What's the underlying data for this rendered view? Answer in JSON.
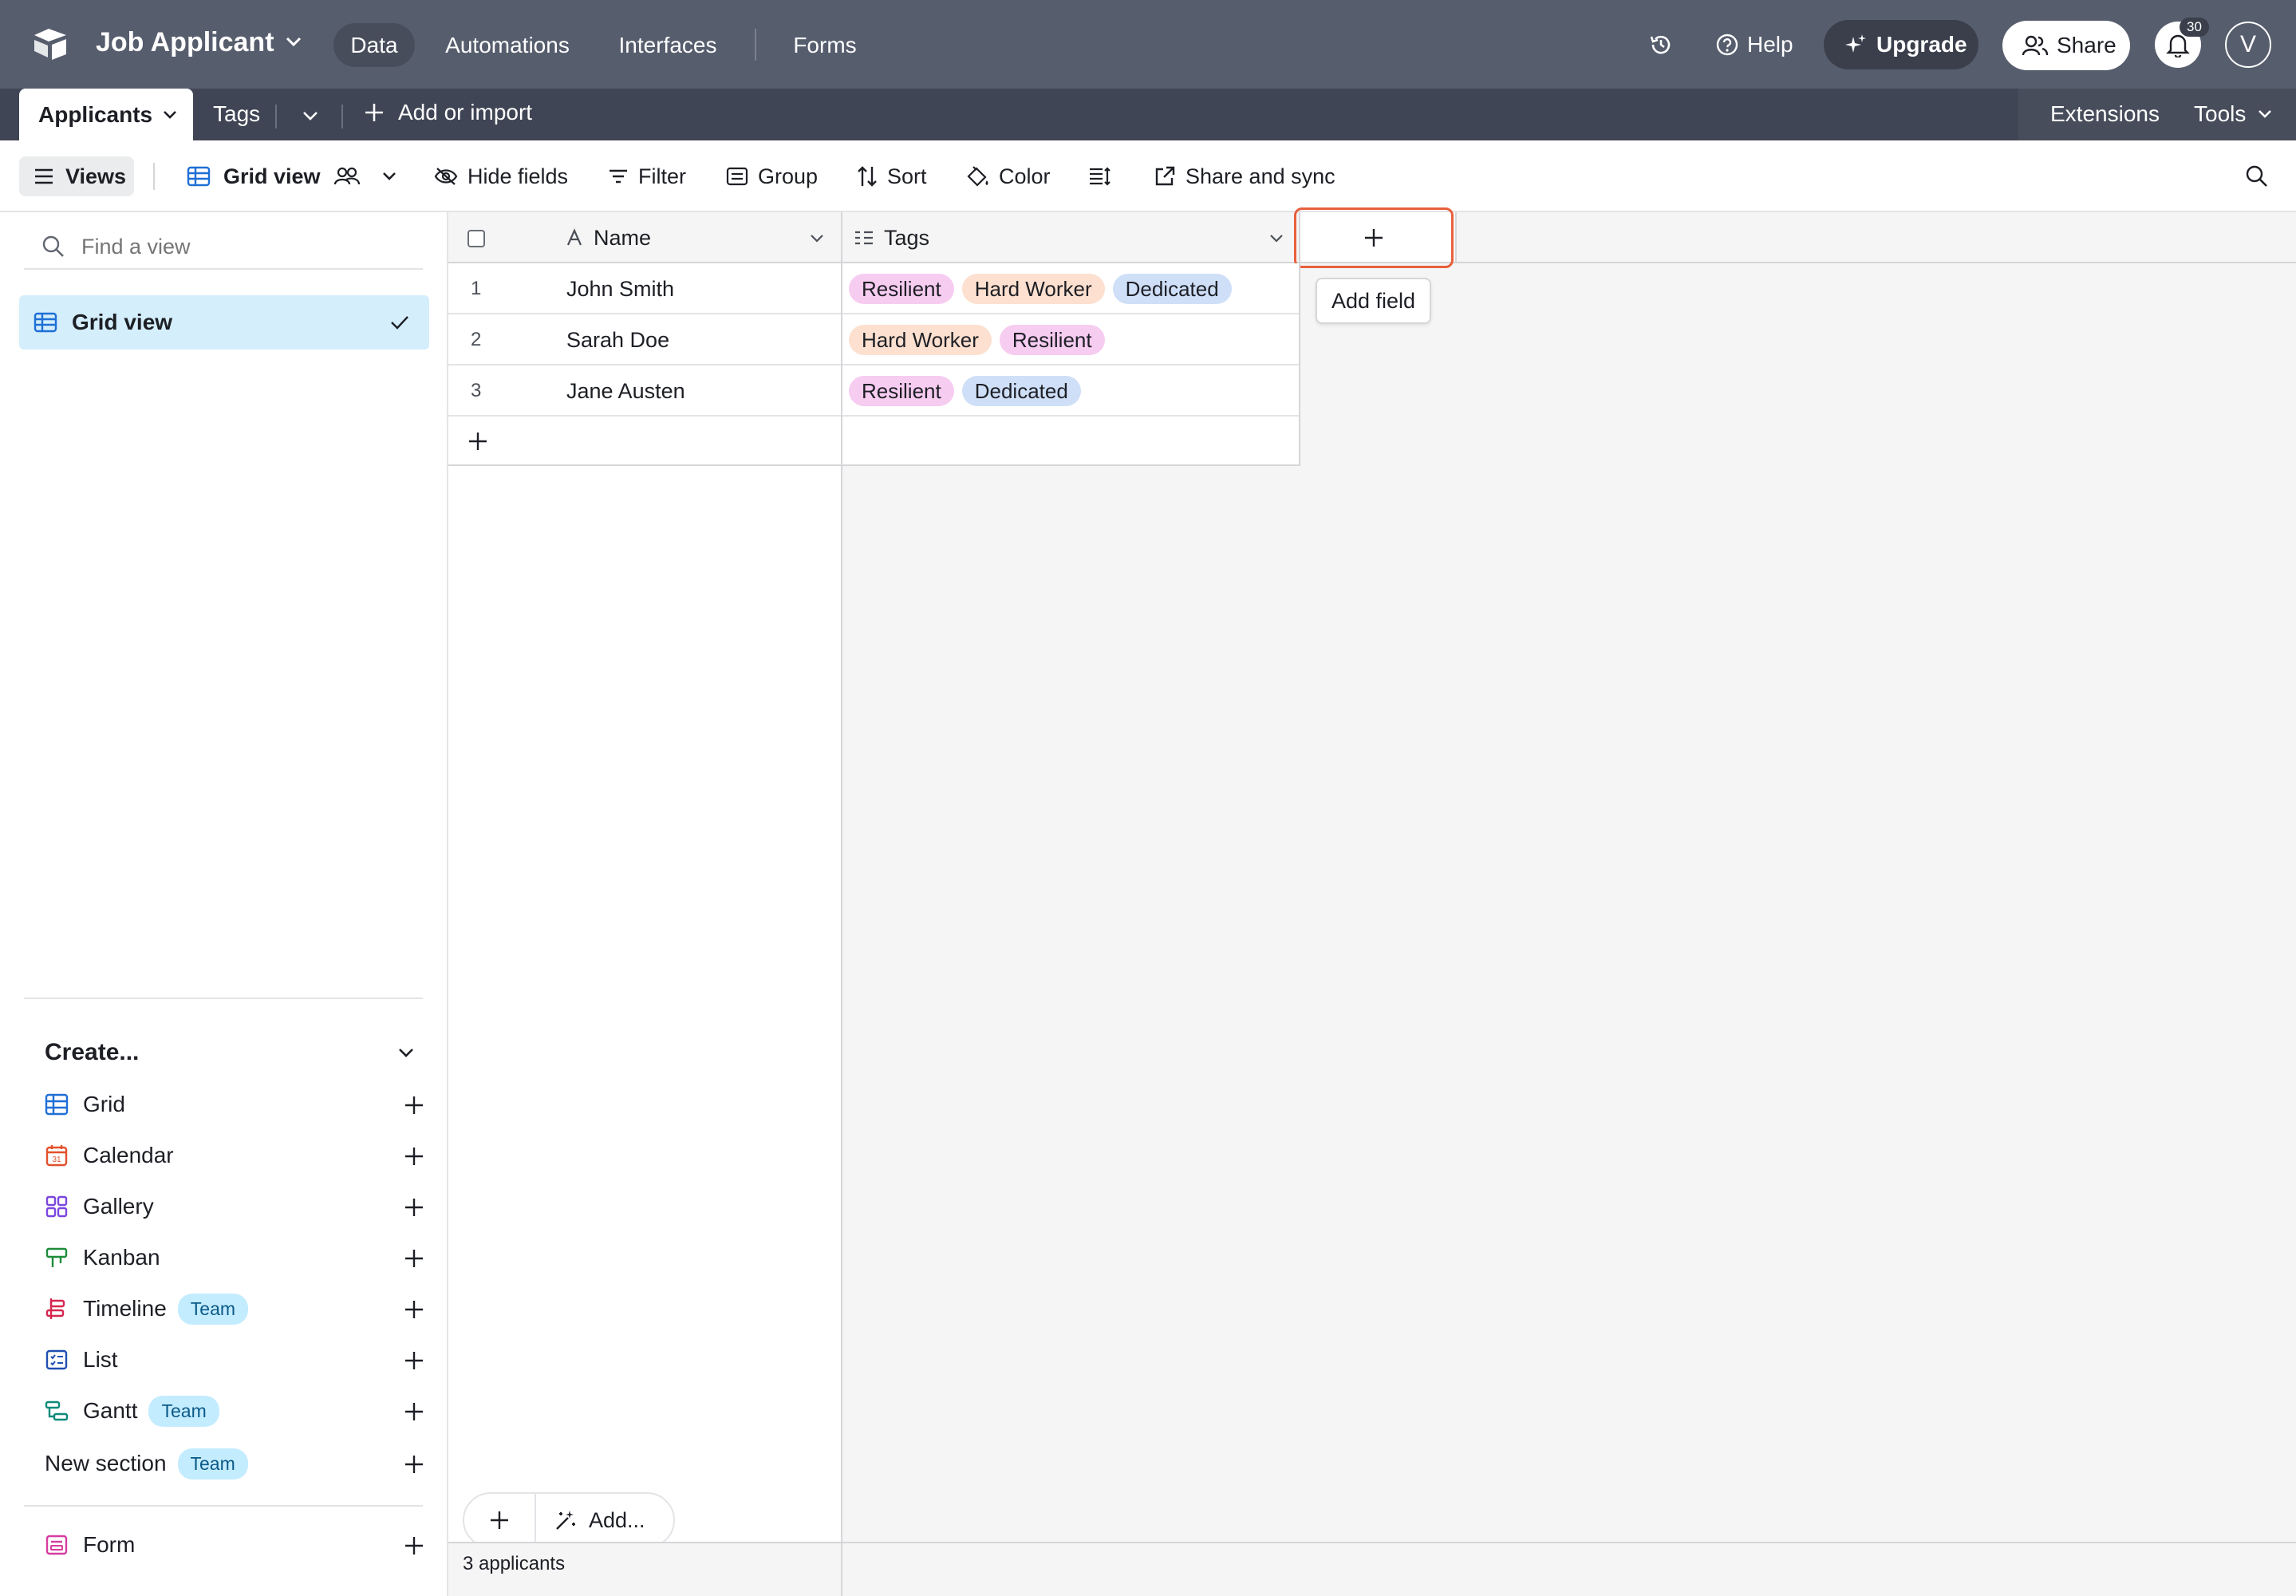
{
  "app": {
    "base_name": "Job Applicant",
    "nav": [
      "Data",
      "Automations",
      "Interfaces",
      "Forms"
    ],
    "help_label": "Help",
    "upgrade_label": "Upgrade",
    "share_label": "Share",
    "notification_count": "30",
    "avatar_initial": "V"
  },
  "tables": {
    "active": "Applicants",
    "other": "Tags",
    "add_label": "Add or import",
    "extensions_label": "Extensions",
    "tools_label": "Tools"
  },
  "toolbar": {
    "views_label": "Views",
    "view_name": "Grid view",
    "hide_fields": "Hide fields",
    "filter": "Filter",
    "group": "Group",
    "sort": "Sort",
    "color": "Color",
    "share_sync": "Share and sync"
  },
  "sidebar": {
    "find_placeholder": "Find a view",
    "active_view": "Grid view",
    "create_label": "Create...",
    "create_items": [
      {
        "label": "Grid",
        "icon": "grid-icon",
        "color": "#1f6fd6"
      },
      {
        "label": "Calendar",
        "icon": "calendar-icon",
        "color": "#e2502a"
      },
      {
        "label": "Gallery",
        "icon": "gallery-icon",
        "color": "#7b46e0"
      },
      {
        "label": "Kanban",
        "icon": "kanban-icon",
        "color": "#1e8c3a"
      },
      {
        "label": "Timeline",
        "icon": "timeline-icon",
        "color": "#d6264f",
        "badge": "Team"
      },
      {
        "label": "List",
        "icon": "list-icon",
        "color": "#1f4fb0"
      },
      {
        "label": "Gantt",
        "icon": "gantt-icon",
        "color": "#0e8a7a",
        "badge": "Team"
      },
      {
        "label": "New section",
        "badge": "Team"
      },
      {
        "label": "Form",
        "icon": "form-icon",
        "color": "#d63ca0"
      }
    ]
  },
  "grid": {
    "columns": [
      "Name",
      "Tags"
    ],
    "rows": [
      {
        "num": "1",
        "name": "John Smith",
        "tags": [
          "Resilient",
          "Hard Worker",
          "Dedicated"
        ]
      },
      {
        "num": "2",
        "name": "Sarah Doe",
        "tags": [
          "Hard Worker",
          "Resilient"
        ]
      },
      {
        "num": "3",
        "name": "Jane Austen",
        "tags": [
          "Resilient",
          "Dedicated"
        ]
      }
    ],
    "add_field_tooltip": "Add field",
    "add_label": "Add...",
    "record_count": "3 applicants"
  },
  "colors": {
    "topbar": "#565d6d",
    "tabbar": "#3f4554",
    "highlight": "#e8603c",
    "selected_view": "#d4eefc"
  }
}
